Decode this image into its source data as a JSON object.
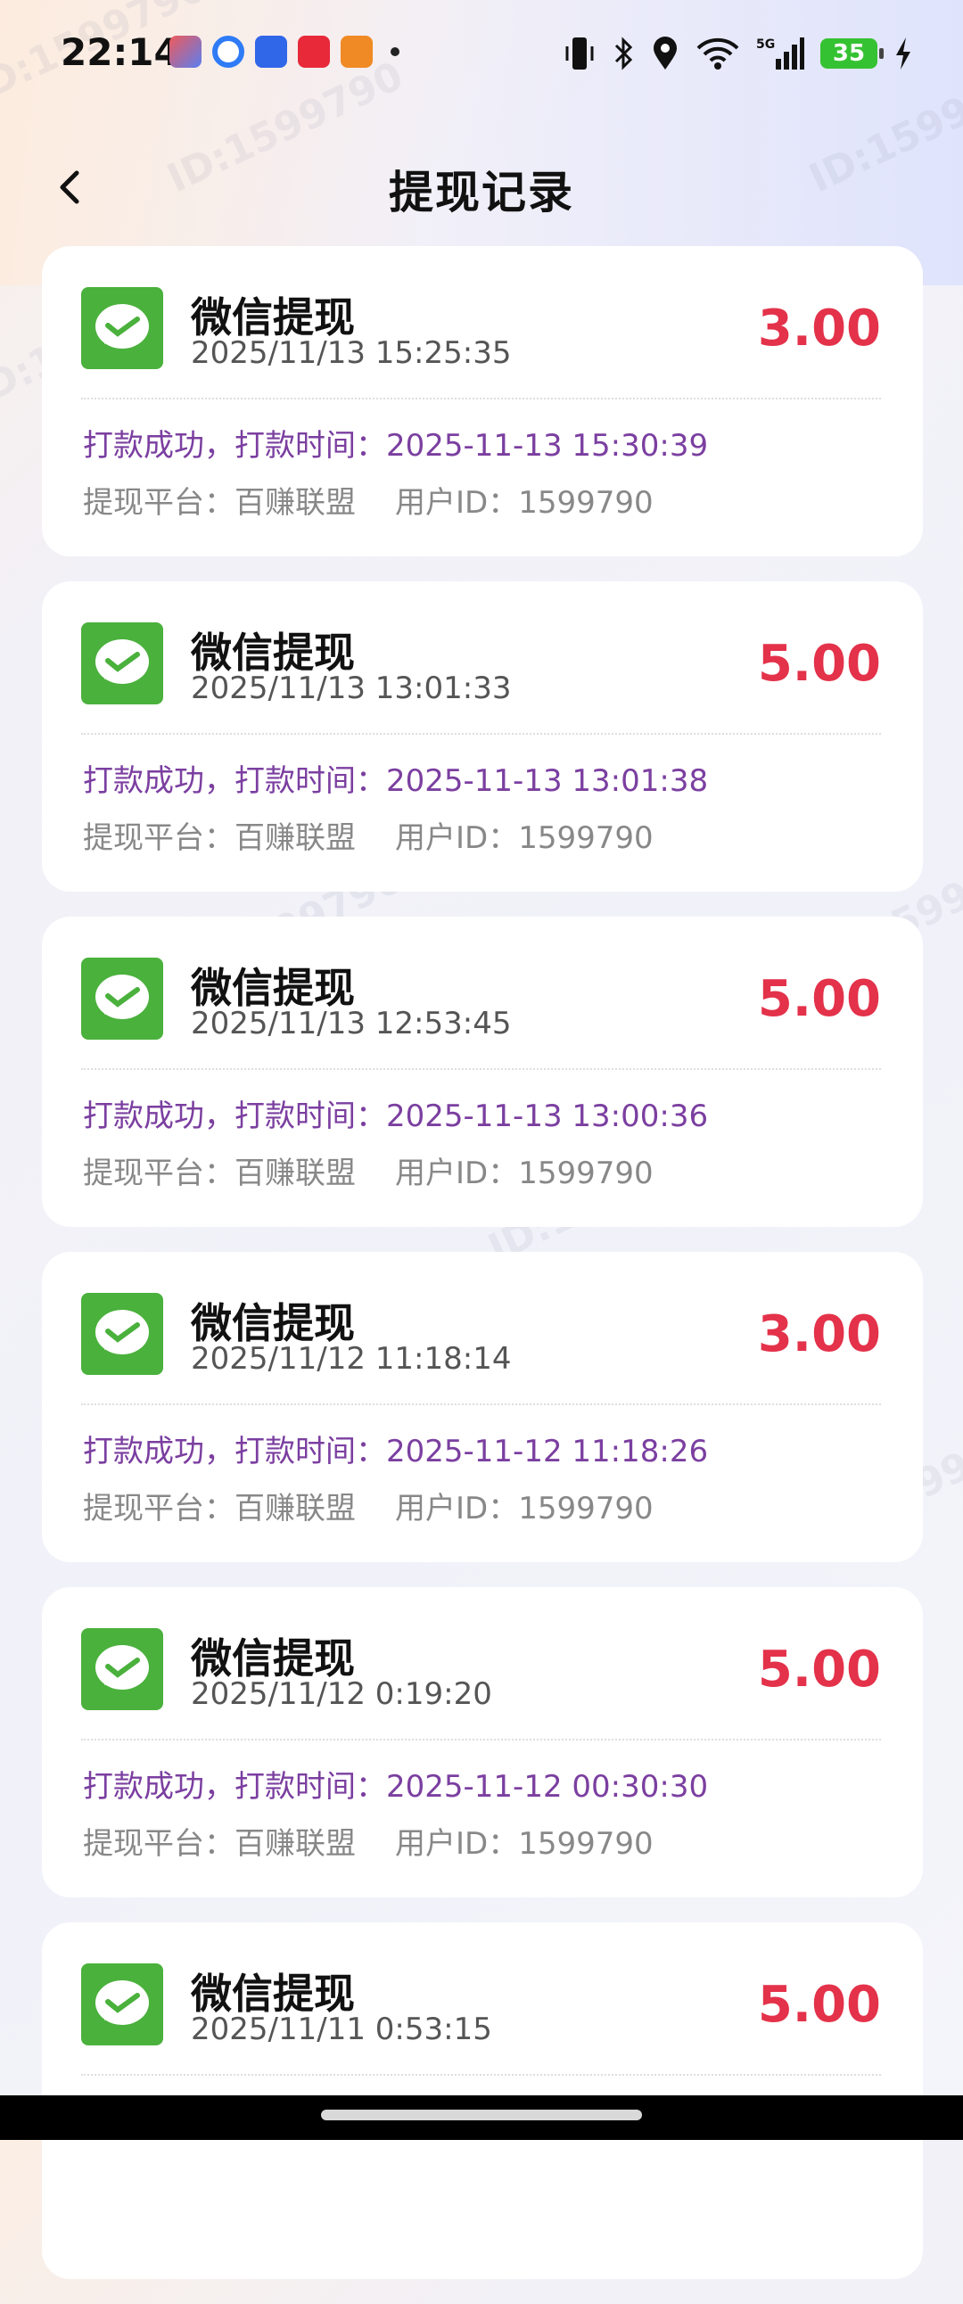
{
  "status_bar": {
    "time": "22:14",
    "battery": "35",
    "network": "5G"
  },
  "header": {
    "title": "提现记录"
  },
  "records": [
    {
      "title": "微信提现",
      "date": "2025/11/13 15:25:35",
      "amount": "3.00",
      "status_prefix": "打款成功，打款时间：",
      "pay_time": "2025-11-13 15:30:39",
      "platform": "提现平台：百赚联盟",
      "user_id": "用户ID：1599790"
    },
    {
      "title": "微信提现",
      "date": "2025/11/13 13:01:33",
      "amount": "5.00",
      "status_prefix": "打款成功，打款时间：",
      "pay_time": "2025-11-13 13:01:38",
      "platform": "提现平台：百赚联盟",
      "user_id": "用户ID：1599790"
    },
    {
      "title": "微信提现",
      "date": "2025/11/13 12:53:45",
      "amount": "5.00",
      "status_prefix": "打款成功，打款时间：",
      "pay_time": "2025-11-13 13:00:36",
      "platform": "提现平台：百赚联盟",
      "user_id": "用户ID：1599790"
    },
    {
      "title": "微信提现",
      "date": "2025/11/12 11:18:14",
      "amount": "3.00",
      "status_prefix": "打款成功，打款时间：",
      "pay_time": "2025-11-12 11:18:26",
      "platform": "提现平台：百赚联盟",
      "user_id": "用户ID：1599790"
    },
    {
      "title": "微信提现",
      "date": "2025/11/12 0:19:20",
      "amount": "5.00",
      "status_prefix": "打款成功，打款时间：",
      "pay_time": "2025-11-12 00:30:30",
      "platform": "提现平台：百赚联盟",
      "user_id": "用户ID：1599790"
    },
    {
      "title": "微信提现",
      "date": "2025/11/11 0:53:15",
      "amount": "5.00"
    }
  ],
  "watermark": "ID:1599790",
  "colors": {
    "amount": "#e3324a",
    "status": "#7b3fa0",
    "wechat": "#4ab13c"
  }
}
